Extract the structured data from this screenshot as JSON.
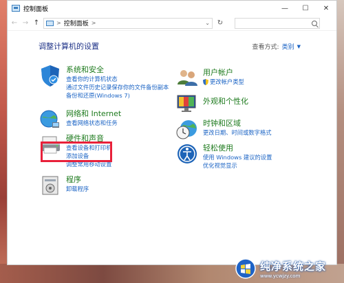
{
  "window": {
    "title": "控制面板",
    "controls": {
      "minimize": "—",
      "maximize": "☐",
      "close": "✕"
    }
  },
  "navbar": {
    "back": "←",
    "forward": "→",
    "up": "↑",
    "address_chevron": ">",
    "address_text": "控制面板",
    "address_chevron_after": ">",
    "address_dropdown": "⌄",
    "refresh": "↻"
  },
  "main": {
    "heading": "调整计算机的设置",
    "view_by_label": "查看方式:",
    "view_by_value": "类别",
    "view_by_caret": "▼"
  },
  "categories": [
    {
      "title": "系统和安全",
      "links": [
        "查看你的计算机状态",
        "通过文件历史记录保存你的文件备份副本",
        "备份和还原(Windows 7)"
      ]
    },
    {
      "title": "网络和 Internet",
      "links": [
        "查看网络状态和任务"
      ]
    },
    {
      "title": "硬件和声音",
      "links": [
        "查看设备和打印机",
        "添加设备",
        "调整常用移动设置"
      ]
    },
    {
      "title": "程序",
      "links": [
        "卸载程序"
      ]
    },
    {
      "title": "用户帐户",
      "links": [
        "更改帐户类型"
      ]
    },
    {
      "title": "外观和个性化",
      "links": []
    },
    {
      "title": "时钟和区域",
      "links": [
        "更改日期、时间或数字格式"
      ]
    },
    {
      "title": "轻松使用",
      "links": [
        "使用 Windows 建议的设置",
        "优化视觉显示"
      ]
    }
  ],
  "watermark": {
    "title": "纯净系统之家",
    "url": "www.ycwjzy.com"
  },
  "colors": {
    "heading": "#1e3287",
    "category_title": "#1d7a1d",
    "link": "#1a63c4",
    "highlight_box": "#e8203a"
  }
}
